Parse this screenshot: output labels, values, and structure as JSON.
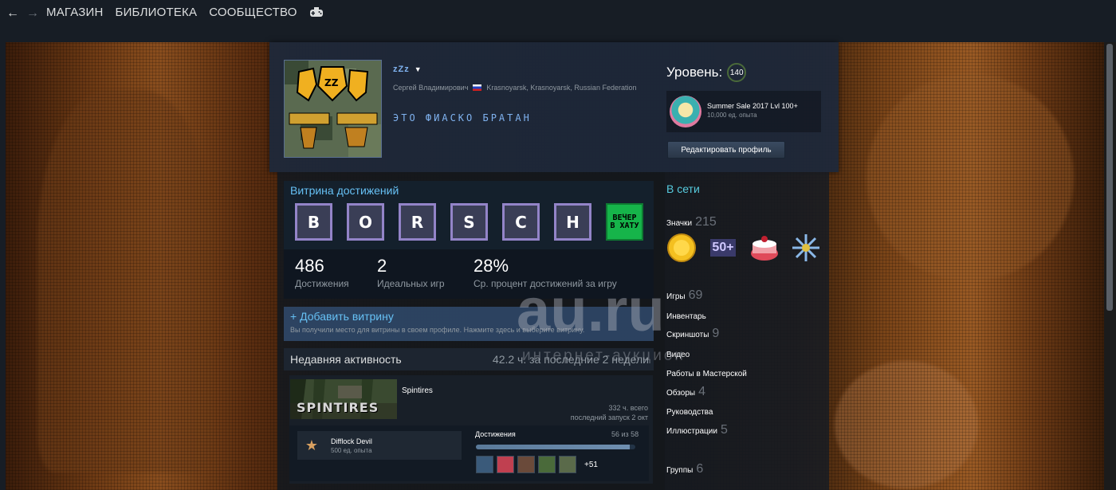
{
  "nav": {
    "back_icon": "arrow-left-icon",
    "forward_icon": "arrow-right-icon",
    "links": [
      "МАГАЗИН",
      "БИБЛИОТЕКА",
      "СООБЩЕСТВО"
    ],
    "bigpicture_icon": "gamepad-icon"
  },
  "profile": {
    "persona_name": "zZz",
    "real_name": "Сергей Владимирович",
    "location": "Krasnoyarsk, Krasnoyarsk, Russian Federation",
    "summary": "ЭТО ФИАСКО БРАТАН",
    "level_label": "Уровень:",
    "level": "140",
    "fav_badge_title": "Summer Sale 2017 Lvl 100+",
    "fav_badge_xp": "10,000 ед. опыта",
    "edit_button": "Редактировать профиль"
  },
  "showcase": {
    "title": "Витрина достижений",
    "tiles": [
      "B",
      "O",
      "R",
      "S",
      "C",
      "H"
    ],
    "green_tile": "ВЕЧЕР В ХАТУ",
    "stats": [
      {
        "value": "486",
        "label": "Достижения"
      },
      {
        "value": "2",
        "label": "Идеальных игр"
      },
      {
        "value": "28%",
        "label": "Ср. процент достижений за игру"
      }
    ]
  },
  "add_showcase": {
    "title": "+ Добавить витрину",
    "desc": "Вы получили место для витрины в своем профиле. Нажмите здесь и выберите витрину."
  },
  "recent": {
    "title": "Недавняя активность",
    "hours": "42.2 ч. за последние 2 недели",
    "game": {
      "name": "Spintires",
      "cover_text": "SPINTIRES",
      "total_hours": "332 ч. всего",
      "last_played": "последний запуск 2 окт",
      "last_ach_name": "Difflock Devil",
      "last_ach_xp": "500 ед. опыта",
      "progress_label": "Достижения",
      "progress_count": "56 из 58",
      "progress_fraction": 0.9655,
      "more": "+51"
    }
  },
  "sidebar": {
    "online": "В сети",
    "badges_label": "Значки",
    "badges_count": "215",
    "badge_50_text": "50+",
    "items": [
      {
        "label": "Игры",
        "count": "69"
      },
      {
        "label": "Инвентарь",
        "count": ""
      },
      {
        "label": "Скриншоты",
        "count": "9"
      },
      {
        "label": "Видео",
        "count": ""
      },
      {
        "label": "Работы в Мастерской",
        "count": ""
      },
      {
        "label": "Обзоры",
        "count": "4"
      },
      {
        "label": "Руководства",
        "count": ""
      },
      {
        "label": "Иллюстрации",
        "count": "5"
      },
      {
        "label": "Группы",
        "count": "6"
      }
    ]
  },
  "watermark": {
    "main": "au.ru",
    "sub": "интернет-аукцион"
  },
  "colors": {
    "accent_blue": "#66c0f4",
    "online_cyan": "#57cbde",
    "tile_border": "#9384c8",
    "tile_green": "#16b44a"
  }
}
